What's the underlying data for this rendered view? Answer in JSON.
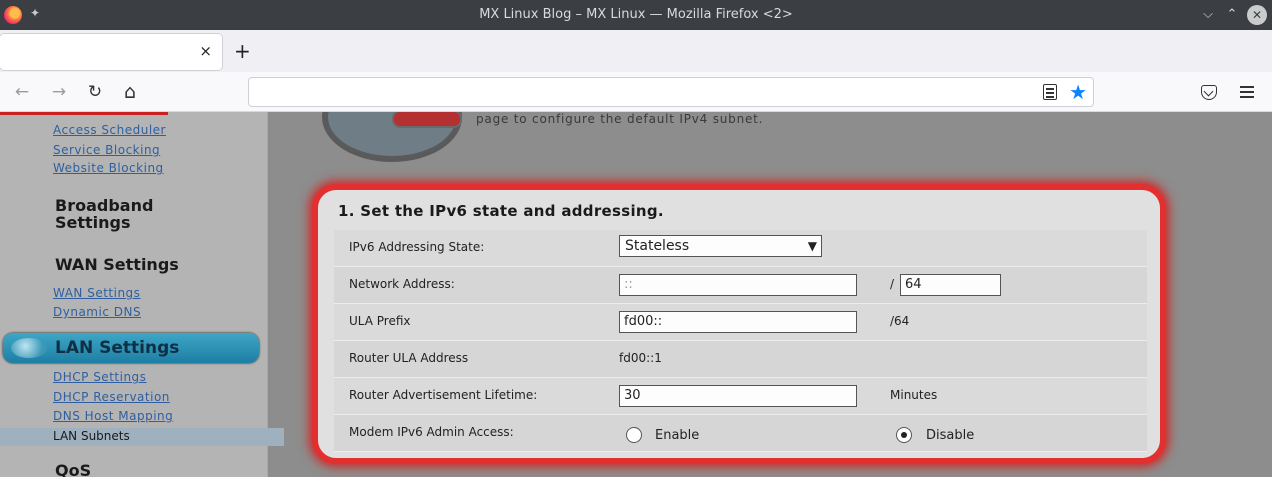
{
  "window": {
    "title": "MX Linux Blog – MX Linux — Mozilla Firefox <2>"
  },
  "tabs": [
    {
      "label": ""
    }
  ],
  "icons": {
    "firefox": "firefox-logo-icon",
    "pin": "pin-icon",
    "minimize": "chevron-down-icon",
    "maximize": "chevron-up-icon",
    "close": "close-icon",
    "back": "arrow-left-icon",
    "forward": "arrow-right-icon",
    "reload": "reload-icon",
    "home": "home-icon",
    "reader": "reader-view-icon",
    "bookmark": "star-icon",
    "pocket": "pocket-icon",
    "menu": "hamburger-menu-icon"
  },
  "glyphs": {
    "minimize": "⌵",
    "maximize": "⌃",
    "close": "✕",
    "tab_close": "×",
    "new_tab": "+",
    "back": "←",
    "forward": "→",
    "reload": "↻",
    "home": "⌂",
    "star": "★",
    "pin": "✦",
    "caret": "▼"
  },
  "colors": {
    "bookmark_star": "#0a84ff",
    "highlight_frame": "#e23030",
    "active_nav": "#1d7ea3"
  },
  "url": {
    "value": ""
  },
  "sidebar": {
    "links_top": [
      "Access Scheduler",
      "Service Blocking",
      "Website Blocking"
    ],
    "broadband_heading_line1": "Broadband",
    "broadband_heading_line2": "Settings",
    "wan_heading": "WAN Settings",
    "wan_links": [
      "WAN Settings",
      "Dynamic DNS"
    ],
    "lan_heading": "LAN Settings",
    "lan_links": [
      "DHCP Settings",
      "DHCP Reservation",
      "DNS Host Mapping"
    ],
    "lan_selected": "LAN Subnets",
    "qos_heading": "QoS"
  },
  "header_text": "page to configure the default IPv4 subnet.",
  "section": {
    "title": "1. Set the IPv6 state and addressing.",
    "rows": {
      "state": {
        "label": "IPv6 Addressing State:",
        "value": "Stateless"
      },
      "network": {
        "label": "Network Address:",
        "value": "::",
        "separator": "/",
        "prefix_length": "64"
      },
      "ula": {
        "label": "ULA Prefix",
        "value": "fd00::",
        "suffix": "/64"
      },
      "router_ula": {
        "label": "Router ULA Address",
        "value": "fd00::1"
      },
      "lifetime": {
        "label": "Router Advertisement Lifetime:",
        "value": "30",
        "unit": "Minutes"
      },
      "admin": {
        "label": "Modem IPv6 Admin Access:",
        "enable": "Enable",
        "disable": "Disable",
        "selected": "Disable"
      }
    }
  }
}
